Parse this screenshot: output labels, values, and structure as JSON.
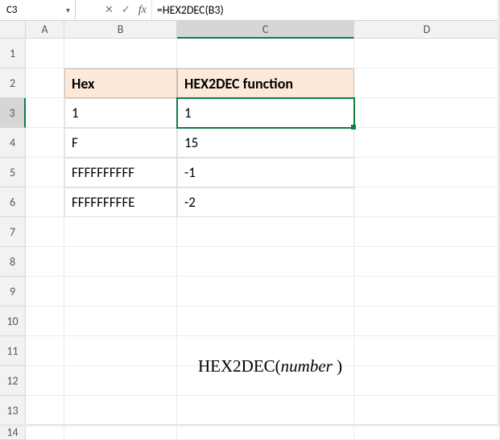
{
  "formula_bar": {
    "name_box": "C3",
    "formula": "=HEX2DEC(B3)"
  },
  "columns": {
    "A": "A",
    "B": "B",
    "C": "C",
    "D": "D"
  },
  "rows": [
    "1",
    "2",
    "3",
    "4",
    "5",
    "6",
    "7",
    "8",
    "9",
    "10",
    "11",
    "12",
    "13",
    "14"
  ],
  "table": {
    "headers": {
      "hex": "Hex",
      "result": "HEX2DEC function"
    },
    "data": [
      {
        "hex": "1",
        "dec": "1"
      },
      {
        "hex": "F",
        "dec": "15"
      },
      {
        "hex": "FFFFFFFFFF",
        "dec": "-1"
      },
      {
        "hex": "FFFFFFFFFE",
        "dec": "-2"
      }
    ]
  },
  "syntax": {
    "fn": "HEX2DEC(",
    "arg": "number",
    "close": " )"
  },
  "selected_cell": "C3"
}
